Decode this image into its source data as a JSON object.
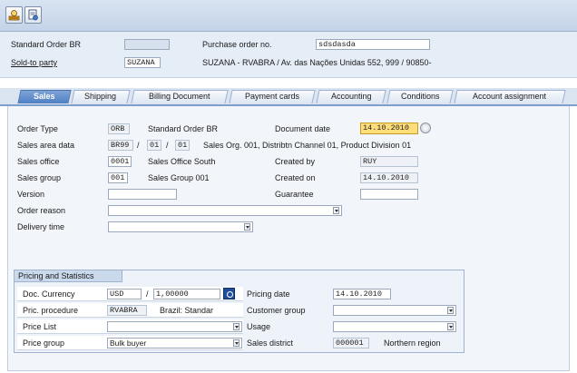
{
  "header": {
    "standard_order_label": "Standard Order BR",
    "standard_order_value": "",
    "purchase_order_label": "Purchase order no.",
    "purchase_order_value": "sdsdasda",
    "sold_to_label": "Sold-to party",
    "sold_to_value": "SUZANA",
    "sold_to_desc": "SUZANA - RVABRA / Av. das Nações Unidas 552, 999 / 90850-"
  },
  "tabs": [
    {
      "label": "Sales",
      "active": true
    },
    {
      "label": "Shipping"
    },
    {
      "label": "Billing Document"
    },
    {
      "label": "Payment cards"
    },
    {
      "label": "Accounting"
    },
    {
      "label": "Conditions"
    },
    {
      "label": "Account assignment"
    }
  ],
  "sales": {
    "order_type_label": "Order Type",
    "order_type_value": "ORB",
    "order_type_desc": "Standard Order BR",
    "document_date_label": "Document date",
    "document_date_value": "14.10.2010",
    "sales_area_label": "Sales area data",
    "sales_org": "BR99",
    "sep1": "/",
    "dist_channel": "01",
    "sep2": "/",
    "division": "01",
    "sales_area_desc": "Sales Org. 001, Distribtn Channel 01, Product Division 01",
    "sales_office_label": "Sales office",
    "sales_office_value": "0001",
    "sales_office_desc": "Sales Office South",
    "created_by_label": "Created by",
    "created_by_value": "RUY",
    "sales_group_label": "Sales group",
    "sales_group_value": "001",
    "sales_group_desc": "Sales Group 001",
    "created_on_label": "Created on",
    "created_on_value": "14.10.2010",
    "version_label": "Version",
    "version_value": "",
    "guarantee_label": "Guarantee",
    "guarantee_value": "",
    "order_reason_label": "Order reason",
    "order_reason_value": "",
    "delivery_time_label": "Delivery time",
    "delivery_time_value": ""
  },
  "pricing": {
    "title": "Pricing and Statistics",
    "doc_currency_label": "Doc. Currency",
    "doc_currency_value": "USD",
    "slash": "/",
    "exchange_rate": "1,00000",
    "pricing_date_label": "Pricing date",
    "pricing_date_value": "14.10.2010",
    "pric_procedure_label": "Pric. procedure",
    "pric_procedure_value": "RVABRA",
    "pric_procedure_desc": "Brazil: Standar",
    "customer_group_label": "Customer group",
    "customer_group_value": "",
    "price_list_label": "Price List",
    "price_list_value": "",
    "usage_label": "Usage",
    "usage_value": "",
    "price_group_label": "Price group",
    "price_group_value": "Bulk buyer",
    "sales_district_label": "Sales district",
    "sales_district_value": "000001",
    "sales_district_desc": "Northern region"
  },
  "icons": {
    "toolbar_1": "user-display-icon",
    "toolbar_2": "document-flow-icon",
    "date_picker": "calendar-picker-icon",
    "currency_picker": "exchange-rate-icon"
  },
  "colors": {
    "active_tab": "#4e7fc4",
    "highlight_field": "#ffde7a"
  }
}
